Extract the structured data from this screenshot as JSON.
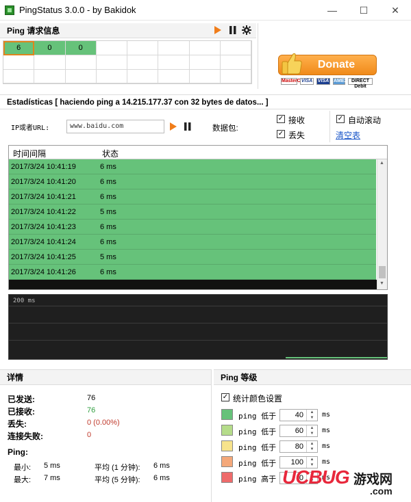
{
  "window": {
    "title": "PingStatus 3.0.0 - by Bakidok",
    "minimize": "—",
    "maximize": "☐",
    "close": "✕"
  },
  "ping_info": {
    "header": "Ping 请求信息",
    "grid_values": [
      "6",
      "0",
      "0"
    ],
    "play_icon": "play-icon",
    "pause_icon": "pause-icon",
    "settings_icon": "gear-icon"
  },
  "donate": {
    "label": "Donate",
    "cards": [
      "MasterCard",
      "VISA",
      "VISA",
      "AMEX",
      "DIRECT Debit"
    ]
  },
  "stats_bar": {
    "text": "Estadísticas  [ haciendo ping a 14.215.177.37 con 32 bytes de datos... ]"
  },
  "controls": {
    "ip_label": "IP或者URL:",
    "ip_value": "www.baidu.com",
    "packets_label": "数据包:",
    "received_label": "接收",
    "lost_label": "丢失",
    "autoscroll_label": "自动滚动",
    "clear_label": "清空表"
  },
  "log_table": {
    "columns": [
      "时间间隔",
      "状态"
    ],
    "rows": [
      {
        "time": "2017/3/24  10:41:19",
        "status": "6 ms"
      },
      {
        "time": "2017/3/24  10:41:20",
        "status": "6 ms"
      },
      {
        "time": "2017/3/24  10:41:21",
        "status": "6 ms"
      },
      {
        "time": "2017/3/24  10:41:22",
        "status": "5 ms"
      },
      {
        "time": "2017/3/24  10:41:23",
        "status": "6 ms"
      },
      {
        "time": "2017/3/24  10:41:24",
        "status": "6 ms"
      },
      {
        "time": "2017/3/24  10:41:25",
        "status": "5 ms"
      },
      {
        "time": "2017/3/24  10:41:26",
        "status": "6 ms"
      }
    ]
  },
  "graph": {
    "label": "200 ms"
  },
  "details": {
    "header": "详情",
    "sent_label": "已发送:",
    "sent_value": "76",
    "received_label": "已接收:",
    "received_value": "76",
    "lost_label": "丢失:",
    "lost_value": "0  (0.00%)",
    "fail_label": "连接失败:",
    "fail_value": "0",
    "ping_label": "Ping:",
    "min_label": "最小:",
    "min_value": "5 ms",
    "max_label": "最大:",
    "max_value": "7 ms",
    "avg1_label": "平均 (1 分钟):",
    "avg1_value": "6 ms",
    "avg5_label": "平均 (5 分钟):",
    "avg5_value": "6 ms"
  },
  "levels": {
    "header": "Ping 等级",
    "stat_color_label": "统计颜色设置",
    "items": [
      {
        "text": "ping 低于",
        "value": "40",
        "unit": "ms",
        "color": "#66c27a"
      },
      {
        "text": "ping 低于",
        "value": "60",
        "unit": "ms",
        "color": "#b5dc8a"
      },
      {
        "text": "ping 低于",
        "value": "80",
        "unit": "ms",
        "color": "#f7e38c"
      },
      {
        "text": "ping 低于",
        "value": "100",
        "unit": "ms",
        "color": "#f4a87a"
      },
      {
        "text": "ping 高于",
        "value": "0",
        "unit": "ms",
        "color": "#ee6b6b"
      }
    ]
  },
  "watermark": {
    "brand": "UCBUG",
    "cn": "游戏网",
    "domain": ".com"
  }
}
